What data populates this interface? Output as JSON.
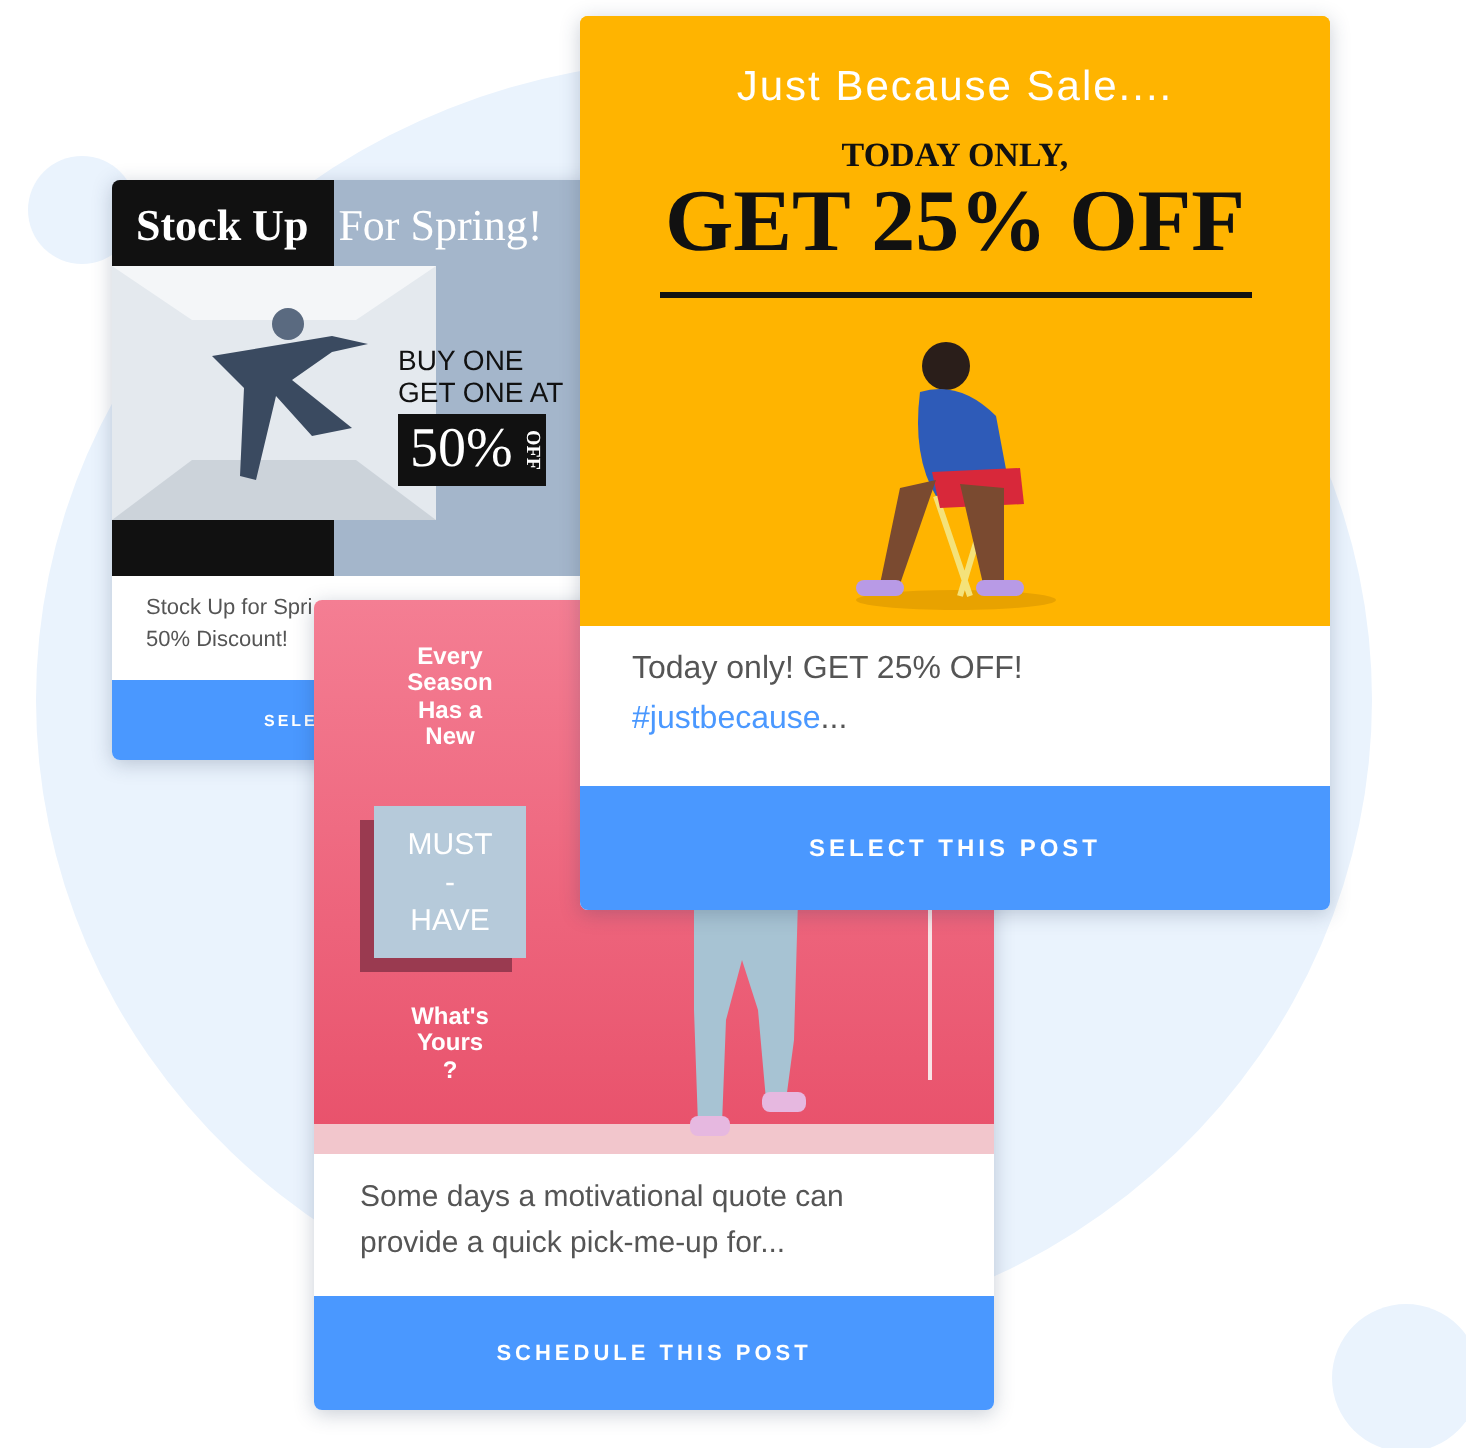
{
  "posts": [
    {
      "kind": "spring",
      "headline": [
        "Stock Up",
        "For Spring!"
      ],
      "offer_lines": [
        "BUY ONE",
        "GET ONE AT"
      ],
      "badge": "50%",
      "badge_side": "OFF",
      "caption_lines": [
        "Stock Up for Spri",
        "50% Discount!"
      ],
      "button": "SELE"
    },
    {
      "kind": "sale",
      "tagline": "Just Because Sale....",
      "kicker": "TODAY ONLY,",
      "headline": "GET 25% OFF",
      "caption": "Today only! GET 25% OFF!",
      "hashtag": "#justbecause",
      "trail": "...",
      "button": "SELECT THIS POST"
    },
    {
      "kind": "season",
      "top_text": "Every Season Has a New",
      "tile": [
        "MUST",
        "-",
        "HAVE"
      ],
      "bottom_text": "What's Yours ?",
      "caption": "Some days a motivational quote can provide a quick pick-me-up for...",
      "button": "SCHEDULE THIS POST"
    }
  ]
}
